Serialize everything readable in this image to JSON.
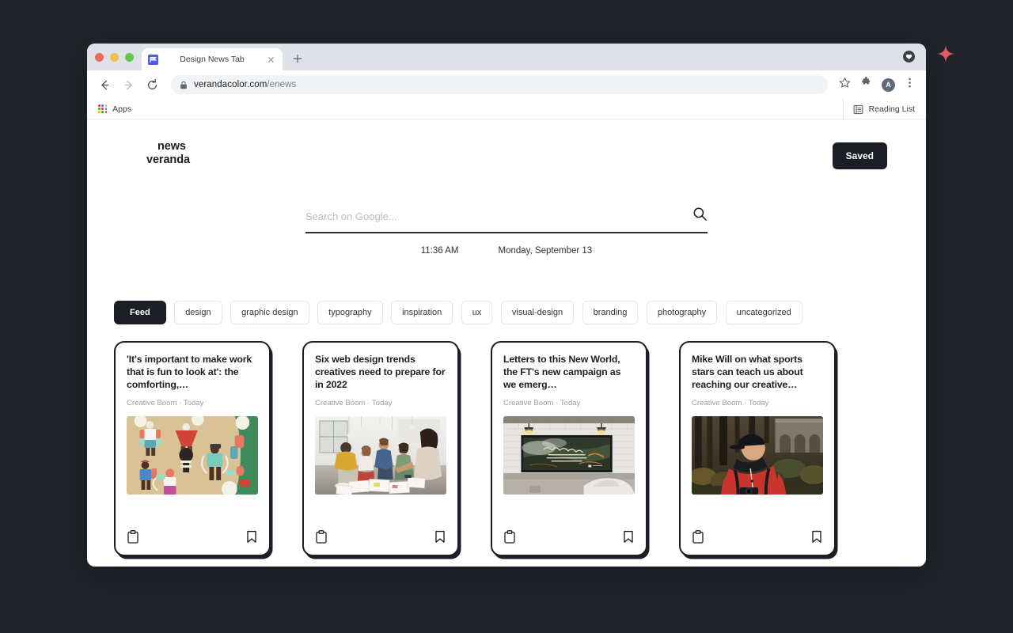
{
  "browser": {
    "tab": {
      "title": "Design News Tab",
      "favicon": "flag-favicon",
      "close": "×"
    },
    "newtab_label": "+",
    "url": {
      "domain": "verandacolor.com",
      "path": "/enews",
      "lock": "lock-icon"
    },
    "bookmarks": {
      "apps_label": "Apps",
      "reading_list_label": "Reading List"
    },
    "profile_initial": "A"
  },
  "header": {
    "logo_line1": "news",
    "logo_line2": "veranda",
    "saved_label": "Saved"
  },
  "search": {
    "placeholder": "Search on Google...",
    "value": "",
    "icon": "search-icon"
  },
  "datetime": {
    "time": "11:36 AM",
    "date": "Monday, September 13"
  },
  "chips": [
    {
      "label": "Feed",
      "active": true
    },
    {
      "label": "design",
      "active": false
    },
    {
      "label": "graphic design",
      "active": false
    },
    {
      "label": "typography",
      "active": false
    },
    {
      "label": "inspiration",
      "active": false
    },
    {
      "label": "ux",
      "active": false
    },
    {
      "label": "visual-design",
      "active": false
    },
    {
      "label": "branding",
      "active": false
    },
    {
      "label": "photography",
      "active": false
    },
    {
      "label": "uncategorized",
      "active": false
    }
  ],
  "cards": [
    {
      "title": "'It's important to make work that is fun to look at': the comforting,…",
      "source": "Creative Boom",
      "separator": "·",
      "time": "Today",
      "image_alt": "paper-cut illustration of people exercising on tan and green background",
      "copy_icon": "clipboard-icon",
      "save_icon": "bookmark-icon"
    },
    {
      "title": "Six web design trends creatives need to prepare for in 2022",
      "source": "Creative Boom",
      "separator": "·",
      "time": "Today",
      "image_alt": "group of creatives kneeling around papers on a studio floor",
      "copy_icon": "clipboard-icon",
      "save_icon": "bookmark-icon"
    },
    {
      "title": "Letters to this New World, the FT's new campaign as we emerg…",
      "source": "Creative Boom",
      "separator": "·",
      "time": "Today",
      "image_alt": "billboard reading To this new world on a white brick wall",
      "copy_icon": "clipboard-icon",
      "save_icon": "bookmark-icon"
    },
    {
      "title": "Mike Will on what sports stars can teach us about reaching our creative…",
      "source": "Creative Boom",
      "separator": "·",
      "time": "Today",
      "image_alt": "man in red jacket with black cap holding a camera in an autumn forest",
      "copy_icon": "clipboard-icon",
      "save_icon": "bookmark-icon"
    }
  ],
  "colors": {
    "accent_dark": "#1b1e24",
    "page_bg": "#ffffff",
    "desktop_bg": "#22262b",
    "sparkle": "#e05a63"
  }
}
